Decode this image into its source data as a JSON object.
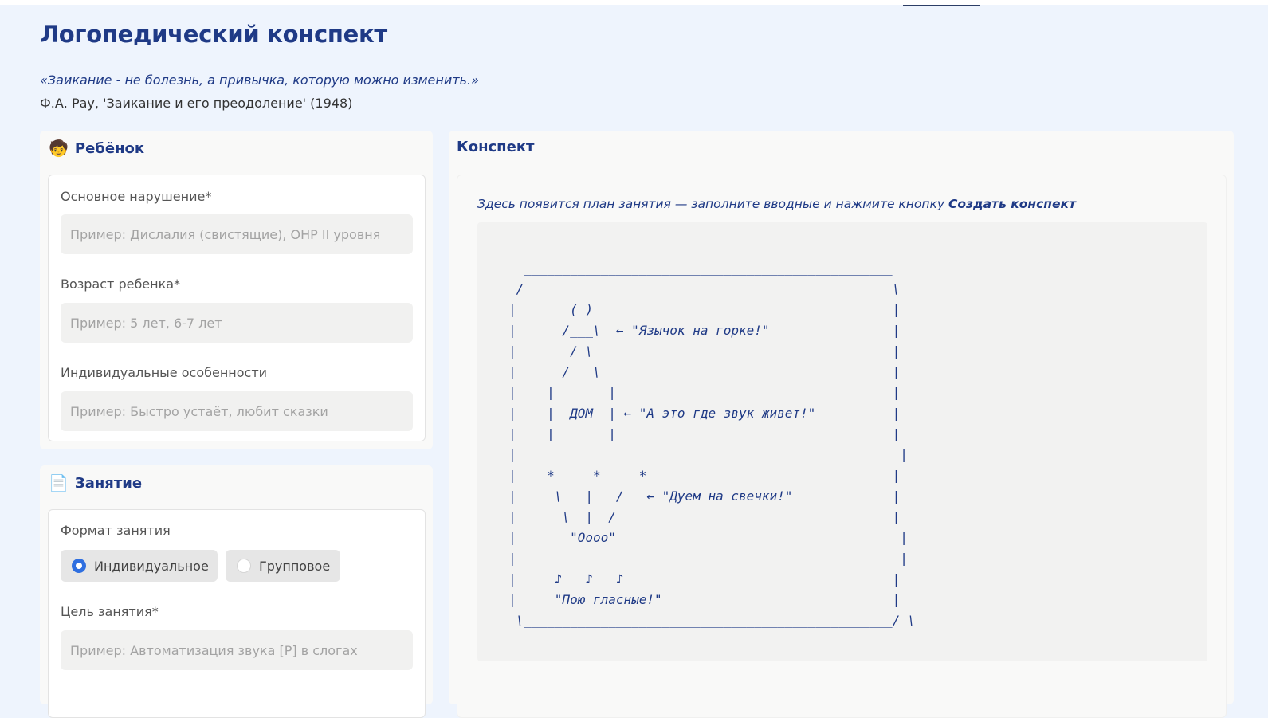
{
  "header": {
    "title": "Логопедический конспект",
    "quote": "«Заикание - не болезнь, а привычка, которую можно изменить.»",
    "quote_source": "Ф.А. Рау, 'Заикание и его преодоление' (1948)"
  },
  "child_panel": {
    "icon": "child-face-icon",
    "title": "Ребёнок",
    "fields": [
      {
        "label": "Основное нарушение*",
        "value": "",
        "placeholder": "Пример: Дислалия (свистящие), ОНР II уровня"
      },
      {
        "label": "Возраст ребенка*",
        "value": "",
        "placeholder": "Пример: 5 лет, 6-7 лет"
      },
      {
        "label": "Индивидуальные особенности",
        "value": "",
        "placeholder": "Пример: Быстро устаёт, любит сказки"
      }
    ]
  },
  "lesson_panel": {
    "icon": "document-icon",
    "title": "Занятие",
    "format_label": "Формат занятия",
    "format_options": [
      {
        "label": "Индивидуальное",
        "selected": true
      },
      {
        "label": "Групповое",
        "selected": false
      }
    ],
    "goal_label": "Цель занятия*",
    "goal_value": "",
    "goal_placeholder": "Пример: Автоматизация звука [Р] в слогах"
  },
  "summary_panel": {
    "title": "Конспект",
    "hint_prefix": "Здесь появится план занятия — заполните вводные и нажмите кнопку ",
    "hint_button": "Создать конспект",
    "ascii_art": "  ________________________________________________\n /                                                \\\n|       ( )                                       |\n|      /___\\  ← \"Язычок на горке!\"                |\n|       / \\                                       |\n|     _/   \\_                                     |\n|    |       |                                    |\n|    |  ДОМ  | ← \"А это где звук живет!\"          |\n|    |_______|                                    |\n|                                                  |\n|    *     *     *                                |\n|     \\   |   /   ← \"Дуем на свечки!\"             |\n|      \\  |  /                                    |\n|       \"Оооо\"                                     |\n|                                                  |\n|     ♪   ♪   ♪                                   |\n|     \"Пою гласные!\"                              |\n \\________________________________________________/ \\"
  }
}
